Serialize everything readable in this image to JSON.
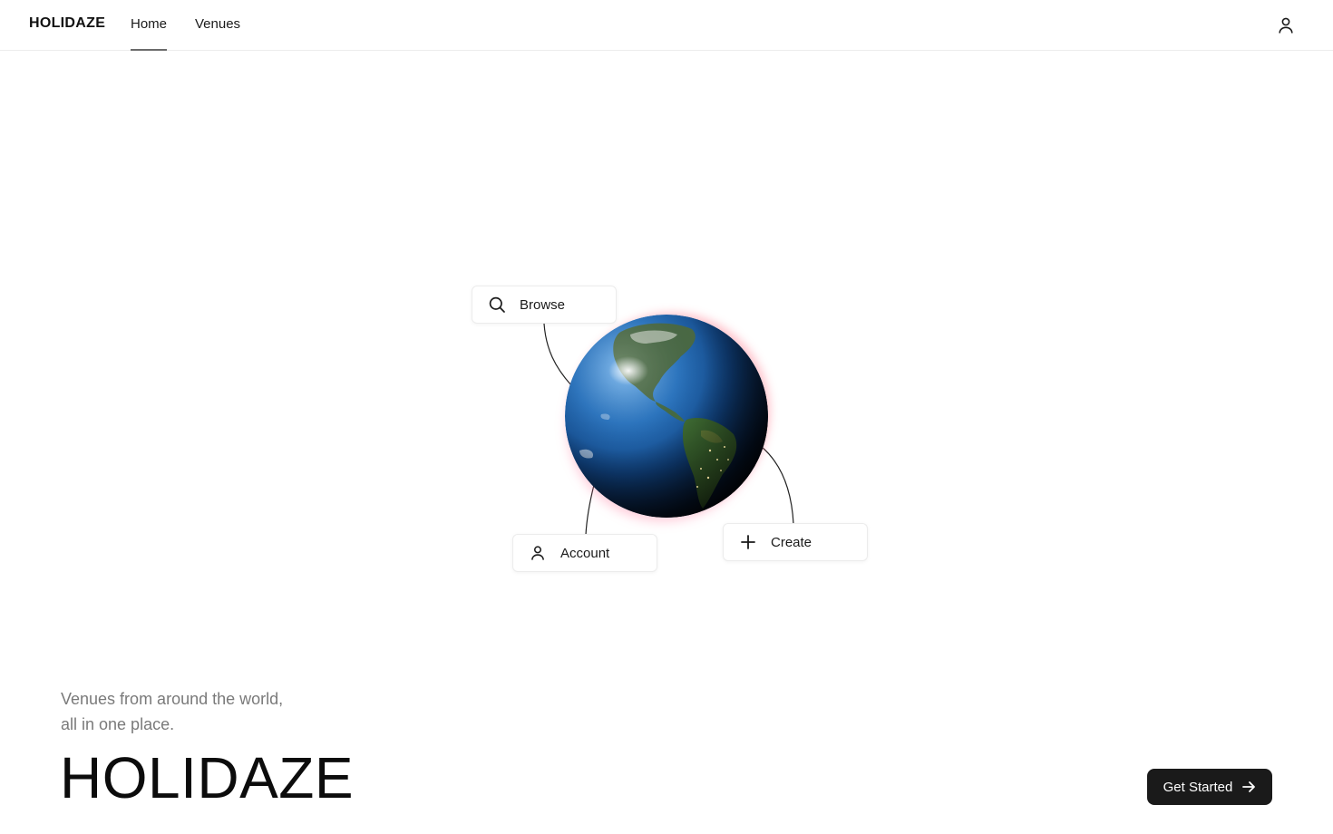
{
  "header": {
    "brand": "HOLIDAZE",
    "nav": {
      "home": "Home",
      "venues": "Venues"
    },
    "active_nav": "Home",
    "profile_icon": "user-icon"
  },
  "hero": {
    "actions": {
      "browse": {
        "label": "Browse",
        "icon": "search-icon"
      },
      "account": {
        "label": "Account",
        "icon": "user-icon"
      },
      "create": {
        "label": "Create",
        "icon": "plus-icon"
      }
    },
    "tagline": "Venues from around the world, all in one place.",
    "title": "HOLIDAZE",
    "cta": {
      "label": "Get Started",
      "icon": "arrow-right-icon"
    }
  },
  "colors": {
    "accent": "#1a1a1a",
    "muted_text": "#7a7a7a",
    "border": "#ececec"
  }
}
